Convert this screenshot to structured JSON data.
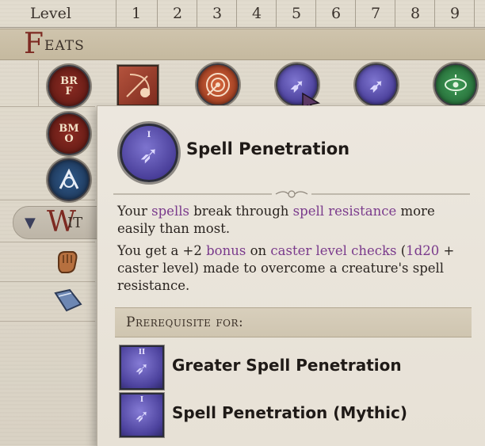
{
  "header": {
    "level_label": "Level",
    "levels": [
      "1",
      "2",
      "3",
      "4",
      "5",
      "6",
      "7",
      "8",
      "9"
    ]
  },
  "feats_band": {
    "cap": "F",
    "rest": "EATS"
  },
  "witch_band": {
    "cap": "W",
    "rest": "IT"
  },
  "grid_icons": {
    "brf": "BR\nF",
    "bmo": "BM\nO"
  },
  "tooltip": {
    "title": "Spell Penetration",
    "desc1": {
      "p1": "Your ",
      "k1": "spells",
      "p2": " break through ",
      "k2": "spell resistance",
      "p3": " more easily than most."
    },
    "desc2": {
      "p1": "You get a +2 ",
      "k1": "bonus",
      "p2": " on ",
      "k2": "caster level checks",
      "p3": " (",
      "k3": "1d20",
      "p4": " + caster level) made to overcome a creature's spell resistance."
    },
    "prereq_label": "Prerequisite for:",
    "prereq_items": [
      {
        "label": "Greater Spell Penetration",
        "tier": "II"
      },
      {
        "label": "Spell Penetration (Mythic)",
        "tier": "I"
      }
    ]
  },
  "colors": {
    "keyword": "#7a3a8c",
    "band_cap": "#7d2a22",
    "spell_icon": "#4a3f9a"
  }
}
